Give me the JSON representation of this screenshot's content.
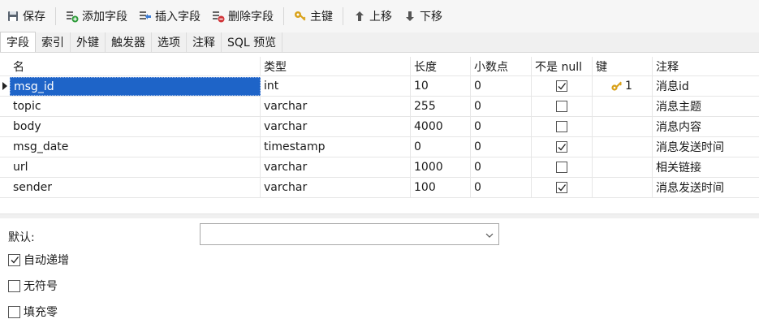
{
  "toolbar": {
    "save": "保存",
    "add_field": "添加字段",
    "insert_field": "插入字段",
    "delete_field": "删除字段",
    "primary_key": "主键",
    "move_up": "上移",
    "move_down": "下移"
  },
  "tabs": [
    "字段",
    "索引",
    "外键",
    "触发器",
    "选项",
    "注释",
    "SQL 预览"
  ],
  "columns": {
    "name": "名",
    "type": "类型",
    "length": "长度",
    "decimals": "小数点",
    "not_null": "不是 null",
    "key": "键",
    "comment": "注释"
  },
  "rows": [
    {
      "name": "msg_id",
      "type": "int",
      "length": "10",
      "decimals": "0",
      "not_null": true,
      "key": "1",
      "comment": "消息id"
    },
    {
      "name": "topic",
      "type": "varchar",
      "length": "255",
      "decimals": "0",
      "not_null": false,
      "key": "",
      "comment": "消息主题"
    },
    {
      "name": "body",
      "type": "varchar",
      "length": "4000",
      "decimals": "0",
      "not_null": false,
      "key": "",
      "comment": "消息内容"
    },
    {
      "name": "msg_date",
      "type": "timestamp",
      "length": "0",
      "decimals": "0",
      "not_null": true,
      "key": "",
      "comment": "消息发送时间"
    },
    {
      "name": "url",
      "type": "varchar",
      "length": "1000",
      "decimals": "0",
      "not_null": false,
      "key": "",
      "comment": "相关链接"
    },
    {
      "name": "sender",
      "type": "varchar",
      "length": "100",
      "decimals": "0",
      "not_null": true,
      "key": "",
      "comment": "消息发送时间"
    }
  ],
  "selected_row": 0,
  "props": {
    "default_label": "默认:",
    "default_value": "",
    "auto_increment": {
      "label": "自动递增",
      "checked": true
    },
    "unsigned": {
      "label": "无符号",
      "checked": false
    },
    "zerofill": {
      "label": "填充零",
      "checked": false
    }
  },
  "icons": {
    "save": "save-icon",
    "add_field": "add-field-icon",
    "insert_field": "insert-field-icon",
    "delete_field": "delete-field-icon",
    "primary_key": "key-icon",
    "move_up": "arrow-up-icon",
    "move_down": "arrow-down-icon"
  },
  "colors": {
    "selection": "#1e64c8",
    "key_gold": "#d9a21b",
    "add_green": "#2e9b3a",
    "delete_red": "#d13438"
  }
}
